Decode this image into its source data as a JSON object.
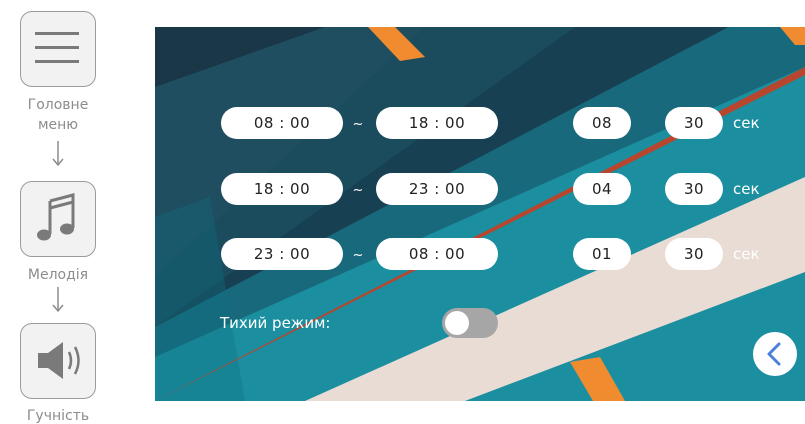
{
  "sidebar": {
    "items": [
      {
        "label": "Головне\nменю",
        "icon": "hamburger-menu-icon"
      },
      {
        "label": "Мелодія",
        "icon": "music-note-icon"
      },
      {
        "label": "Гучність",
        "icon": "speaker-volume-icon"
      }
    ]
  },
  "schedule": {
    "separator": "~",
    "rows": [
      {
        "start": "08 : 00",
        "end": "18 : 00",
        "count": "08",
        "duration": "30",
        "unit": "сек"
      },
      {
        "start": "18 : 00",
        "end": "23 : 00",
        "count": "04",
        "duration": "30",
        "unit": "сек"
      },
      {
        "start": "23 : 00",
        "end": "08 : 00",
        "count": "01",
        "duration": "30",
        "unit": "сек"
      }
    ]
  },
  "silent_mode": {
    "label": "Тихий режим:",
    "enabled": false
  },
  "navigation": {
    "back_icon": "chevron-left-icon"
  },
  "colors": {
    "accent": "#4a7fdc",
    "toggle_off": "#a6a6a6",
    "nav_text": "#8c8c8c"
  }
}
